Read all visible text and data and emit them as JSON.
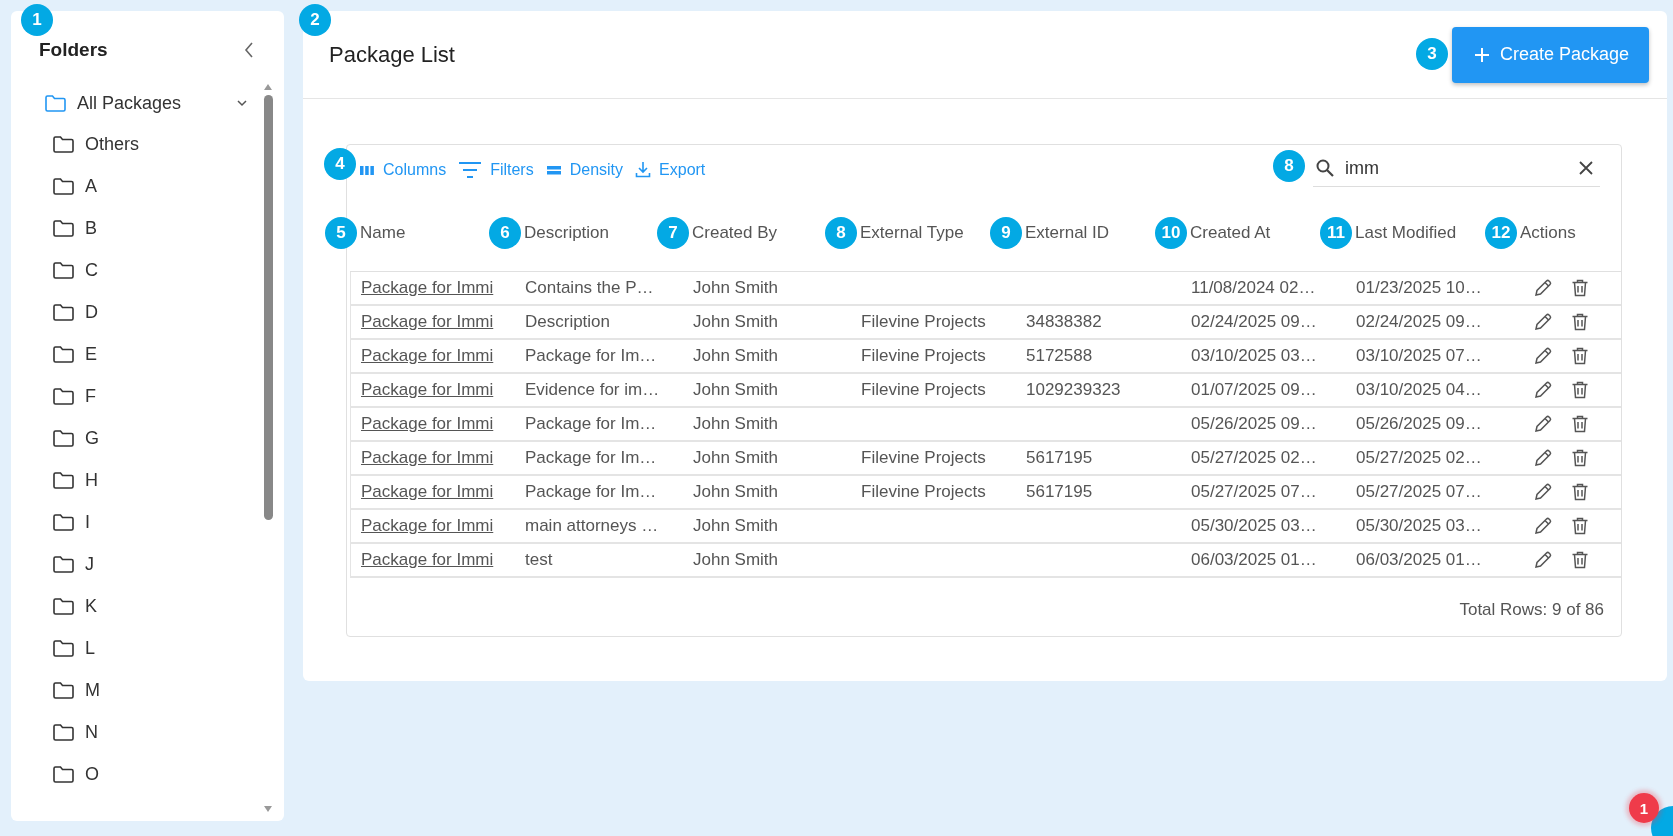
{
  "sidebar": {
    "callout": "1",
    "title": "Folders",
    "folders": [
      {
        "label": "All Packages",
        "selected": true,
        "expanded": true,
        "children": [
          {
            "label": "Others",
            "selected": false
          },
          {
            "label": "A",
            "selected": false
          },
          {
            "label": "B",
            "selected": false
          },
          {
            "label": "C",
            "selected": false
          },
          {
            "label": "D",
            "selected": false
          },
          {
            "label": "E",
            "selected": false
          },
          {
            "label": "F",
            "selected": false
          },
          {
            "label": "G",
            "selected": false
          },
          {
            "label": "H",
            "selected": false
          },
          {
            "label": "I",
            "selected": false
          },
          {
            "label": "J",
            "selected": false
          },
          {
            "label": "K",
            "selected": false
          },
          {
            "label": "L",
            "selected": false
          },
          {
            "label": "M",
            "selected": false
          },
          {
            "label": "N",
            "selected": false
          },
          {
            "label": "O",
            "selected": false
          }
        ]
      }
    ]
  },
  "main": {
    "callout": "2",
    "title": "Package List",
    "create_button": {
      "callout": "3",
      "label": "Create Package"
    },
    "toolbar": {
      "callout": "4",
      "buttons": [
        {
          "kind": "columns",
          "label": "Columns"
        },
        {
          "kind": "filters",
          "label": "Filters"
        },
        {
          "kind": "density",
          "label": "Density"
        },
        {
          "kind": "export",
          "label": "Export"
        }
      ]
    },
    "search": {
      "callout": "8",
      "value": "imm"
    },
    "table": {
      "columns": [
        {
          "label": "Name",
          "callout": "5"
        },
        {
          "label": "Description",
          "callout": "6"
        },
        {
          "label": "Created By",
          "callout": "7"
        },
        {
          "label": "External Type",
          "callout": "8"
        },
        {
          "label": "External ID",
          "callout": "9"
        },
        {
          "label": "Created At",
          "callout": "10"
        },
        {
          "label": "Last Modified",
          "callout": "11"
        },
        {
          "label": "Actions",
          "callout": "12"
        }
      ],
      "rows": [
        {
          "name": "Package for Immi",
          "description": "Contains the P…",
          "created_by": "John Smith",
          "created_at": "11/08/2024 02…",
          "last_modified": "01/23/2025 10…"
        },
        {
          "name": "Package for Immi",
          "description": "Description",
          "created_by": "John Smith",
          "external_type": "Filevine Projects",
          "external_id": "34838382",
          "created_at": "02/24/2025 09…",
          "last_modified": "02/24/2025 09…"
        },
        {
          "name": "Package for Immi",
          "description": "Package for Im…",
          "created_by": "John Smith",
          "external_type": "Filevine Projects",
          "external_id": "5172588",
          "created_at": "03/10/2025 03…",
          "last_modified": "03/10/2025 07…"
        },
        {
          "name": "Package for Immi",
          "description": "Evidence for im…",
          "created_by": "John Smith",
          "external_type": "Filevine Projects",
          "external_id": "1029239323",
          "created_at": "01/07/2025 09…",
          "last_modified": "03/10/2025 04…"
        },
        {
          "name": "Package for Immi",
          "description": "Package for Im…",
          "created_by": "John Smith",
          "created_at": "05/26/2025 09…",
          "last_modified": "05/26/2025 09…"
        },
        {
          "name": "Package for Immi",
          "description": "Package for Im…",
          "created_by": "John Smith",
          "external_type": "Filevine Projects",
          "external_id": "5617195",
          "created_at": "05/27/2025 02…",
          "last_modified": "05/27/2025 02…"
        },
        {
          "name": "Package for Immi",
          "description": "Package for Im…",
          "created_by": "John Smith",
          "external_type": "Filevine Projects",
          "external_id": "5617195",
          "created_at": "05/27/2025 07…",
          "last_modified": "05/27/2025 07…"
        },
        {
          "name": "Package for Immi",
          "description": "main attorneys …",
          "created_by": "John Smith",
          "created_at": "05/30/2025 03…",
          "last_modified": "05/30/2025 03…"
        },
        {
          "name": "Package for Immi",
          "description": "test",
          "created_by": "John Smith",
          "created_at": "06/03/2025 01…",
          "last_modified": "06/03/2025 01…"
        }
      ]
    },
    "footer": "Total Rows: 9 of 86"
  },
  "help": {
    "badge": "1"
  }
}
